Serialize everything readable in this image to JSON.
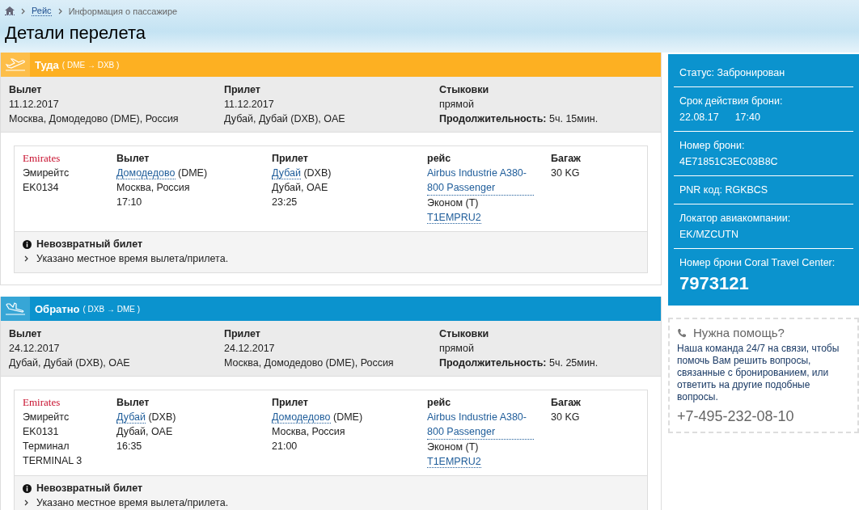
{
  "breadcrumbs": [
    {
      "label": "Рейс",
      "kind": "link"
    },
    {
      "label": "Информация о пассажире",
      "kind": "current"
    }
  ],
  "page_title": "Детали перелета",
  "legs": [
    {
      "title": "Туда",
      "route": "( DME → DXB )",
      "color": "#fdb022",
      "summary": {
        "departure": {
          "label": "Вылет",
          "date": "11.12.2017",
          "place": "Москва, Домодедово (DME), Россия"
        },
        "arrival": {
          "label": "Прилет",
          "date": "11.12.2017",
          "place": "Дубай, Дубай (DXB), OAE"
        },
        "connections": {
          "label": "Стыковки",
          "value": "прямой",
          "duration_label": "Продолжительность:",
          "duration": "5ч. 15мин."
        }
      },
      "segment": {
        "logo": "Emirates",
        "airline": "Эмирейтс",
        "details": [
          "EK0134"
        ],
        "departure": {
          "label": "Вылет",
          "airport": "Домодедово",
          "code": "(DME)",
          "city": "Москва, Россия",
          "time": "17:10"
        },
        "arrival": {
          "label": "Прилет",
          "airport": "Дубай",
          "code": "(DXB)",
          "city": "Дубай, OAE",
          "time": "23:25"
        },
        "flight": {
          "label": "рейс",
          "aircraft": "Airbus Industrie A380-800 Passenger",
          "cabin": "Эконом (Т)",
          "fare": "T1EMPRU2"
        },
        "baggage": {
          "label": "Багаж",
          "value": "30 KG"
        }
      },
      "notes": {
        "title": "Невозвратный билет",
        "items": [
          "Указано местное время вылета/прилета."
        ]
      }
    },
    {
      "title": "Обратно",
      "route": "( DXB → DME )",
      "color": "#0b93ce",
      "summary": {
        "departure": {
          "label": "Вылет",
          "date": "24.12.2017",
          "place": "Дубай, Дубай (DXB), OAE"
        },
        "arrival": {
          "label": "Прилет",
          "date": "24.12.2017",
          "place": "Москва, Домодедово (DME), Россия"
        },
        "connections": {
          "label": "Стыковки",
          "value": "прямой",
          "duration_label": "Продолжительность:",
          "duration": "5ч. 25мин."
        }
      },
      "segment": {
        "logo": "Emirates",
        "airline": "Эмирейтс",
        "details": [
          "EK0131",
          "Терминал",
          "TERMINAL 3"
        ],
        "departure": {
          "label": "Вылет",
          "airport": "Дубай",
          "code": "(DXB)",
          "city": "Дубай, OAE",
          "time": "16:35"
        },
        "arrival": {
          "label": "Прилет",
          "airport": "Домодедово",
          "code": "(DME)",
          "city": "Москва, Россия",
          "time": "21:00"
        },
        "flight": {
          "label": "рейс",
          "aircraft": "Airbus Industrie A380-800 Passenger",
          "cabin": "Эконом (Т)",
          "fare": "T1EMPRU2"
        },
        "baggage": {
          "label": "Багаж",
          "value": "30 KG"
        }
      },
      "notes": {
        "title": "Невозвратный билет",
        "items": [
          "Указано местное время вылета/прилета."
        ]
      }
    }
  ],
  "booking": [
    {
      "kind": "inline",
      "text": "Статус: Забронирован"
    },
    {
      "kind": "pair",
      "label": "Срок действия брони:",
      "values": [
        "22.08.17",
        "17:40"
      ]
    },
    {
      "kind": "pair",
      "label": "Номер брони:",
      "values": [
        "4E71851C3EC03B8C"
      ]
    },
    {
      "kind": "inline",
      "text": "PNR код: RGKBCS"
    },
    {
      "kind": "pair",
      "label": "Локатор авиакомпании:",
      "values": [
        "EK/MZCUTN"
      ]
    },
    {
      "kind": "big",
      "label": "Номер брони Coral Travel Center:",
      "values": [
        "7973121"
      ]
    }
  ],
  "help": {
    "title": "Нужна помощь?",
    "text": "Наша команда 24/7 на связи, чтобы помочь Вам решить вопросы, связанные с бронированием, или ответить на другие подобные вопросы.",
    "phone": "+7-495-232-08-10"
  }
}
